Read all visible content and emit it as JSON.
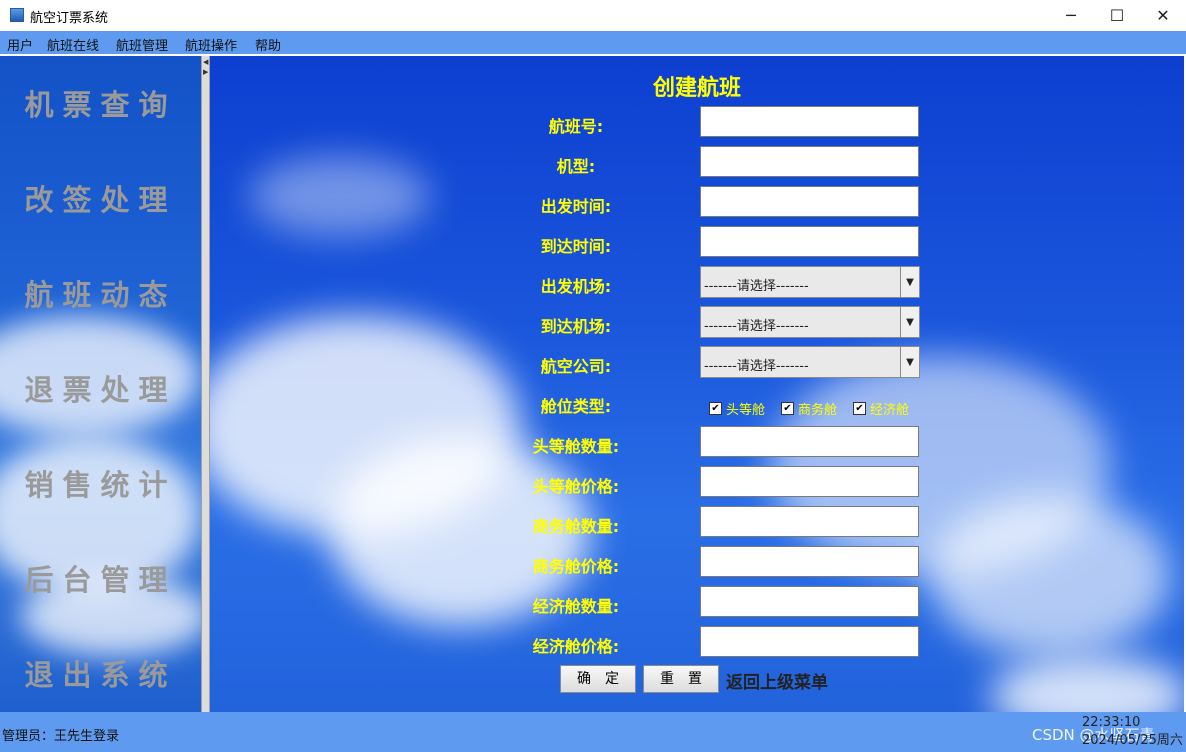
{
  "window": {
    "title": "航空订票系统",
    "minimize": "─",
    "maximize": "☐",
    "close": "✕"
  },
  "menu": [
    "用户",
    "航班在线",
    "航班管理",
    "航班操作",
    "帮助"
  ],
  "sidebar": {
    "items": [
      "机票查询",
      "改签处理",
      "航班动态",
      "退票处理",
      "销售统计",
      "后台管理",
      "退出系统"
    ]
  },
  "form": {
    "title": "创建航班",
    "labels": {
      "flight_no": "航班号:",
      "model": "机型:",
      "depart_time": "出发时间:",
      "arrive_time": "到达时间:",
      "depart_airport": "出发机场:",
      "arrive_airport": "到达机场:",
      "airline": "航空公司:",
      "cabin_type": "舱位类型:",
      "first_qty": "头等舱数量:",
      "first_price": "头等舱价格:",
      "business_qty": "商务舱数量:",
      "business_price": "商务舱价格:",
      "economy_qty": "经济舱数量:",
      "economy_price": "经济舱价格:"
    },
    "select_placeholder": "-------请选择-------",
    "cabins": [
      {
        "label": "头等舱",
        "checked": true
      },
      {
        "label": "商务舱",
        "checked": true
      },
      {
        "label": "经济舱",
        "checked": true
      }
    ],
    "confirm_label": "确定",
    "reset_label": "重置",
    "back_label": "返回上级菜单"
  },
  "status": {
    "user": "管理员：王先生登录",
    "time": "22:33:10",
    "date": "2024/05/25周六",
    "watermark": "CSDN @水坚石青"
  },
  "colors": {
    "menubar": "#5e9bf0",
    "label_yellow": "#ffff00",
    "sidebar_text": "#9a9a9a"
  }
}
